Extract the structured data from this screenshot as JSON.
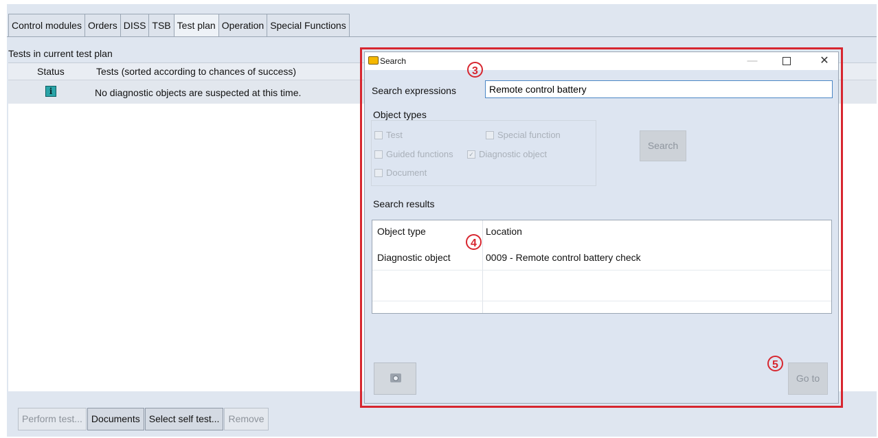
{
  "tabs": [
    "Control modules",
    "Orders",
    "DISS",
    "TSB",
    "Test plan",
    "Operation",
    "Special Functions"
  ],
  "active_tab": "Test plan",
  "test_plan": {
    "title": "Tests in current test plan",
    "columns": {
      "status": "Status",
      "tests": "Tests (sorted according to chances of success)"
    },
    "rows": [
      {
        "status_icon": "info-icon",
        "text": "No diagnostic objects are suspected at this time."
      }
    ]
  },
  "buttons": {
    "perform_test": "Perform test...",
    "documents": "Documents",
    "select_self_test": "Select self test...",
    "remove": "Remove"
  },
  "dialog": {
    "title": "Search",
    "search_expressions_label": "Search expressions",
    "search_value": "Remote control battery",
    "object_types_label": "Object types",
    "object_types": [
      {
        "label": "Test",
        "checked": false
      },
      {
        "label": "Special function",
        "checked": false
      },
      {
        "label": "Guided functions",
        "checked": false
      },
      {
        "label": "Diagnostic object",
        "checked": true
      },
      {
        "label": "Document",
        "checked": false
      }
    ],
    "search_button": "Search",
    "search_results_label": "Search results",
    "results_columns": {
      "type": "Object type",
      "location": "Location"
    },
    "results": [
      {
        "type": "Diagnostic object",
        "location": "0009  - Remote control battery check"
      }
    ],
    "go_to_button": "Go to",
    "camera_icon": "camera-icon"
  },
  "callouts": [
    "3",
    "4",
    "5"
  ],
  "colors": {
    "highlight": "#d7262f",
    "background": "#dfe6f0",
    "dialog": "#dde5f1"
  }
}
